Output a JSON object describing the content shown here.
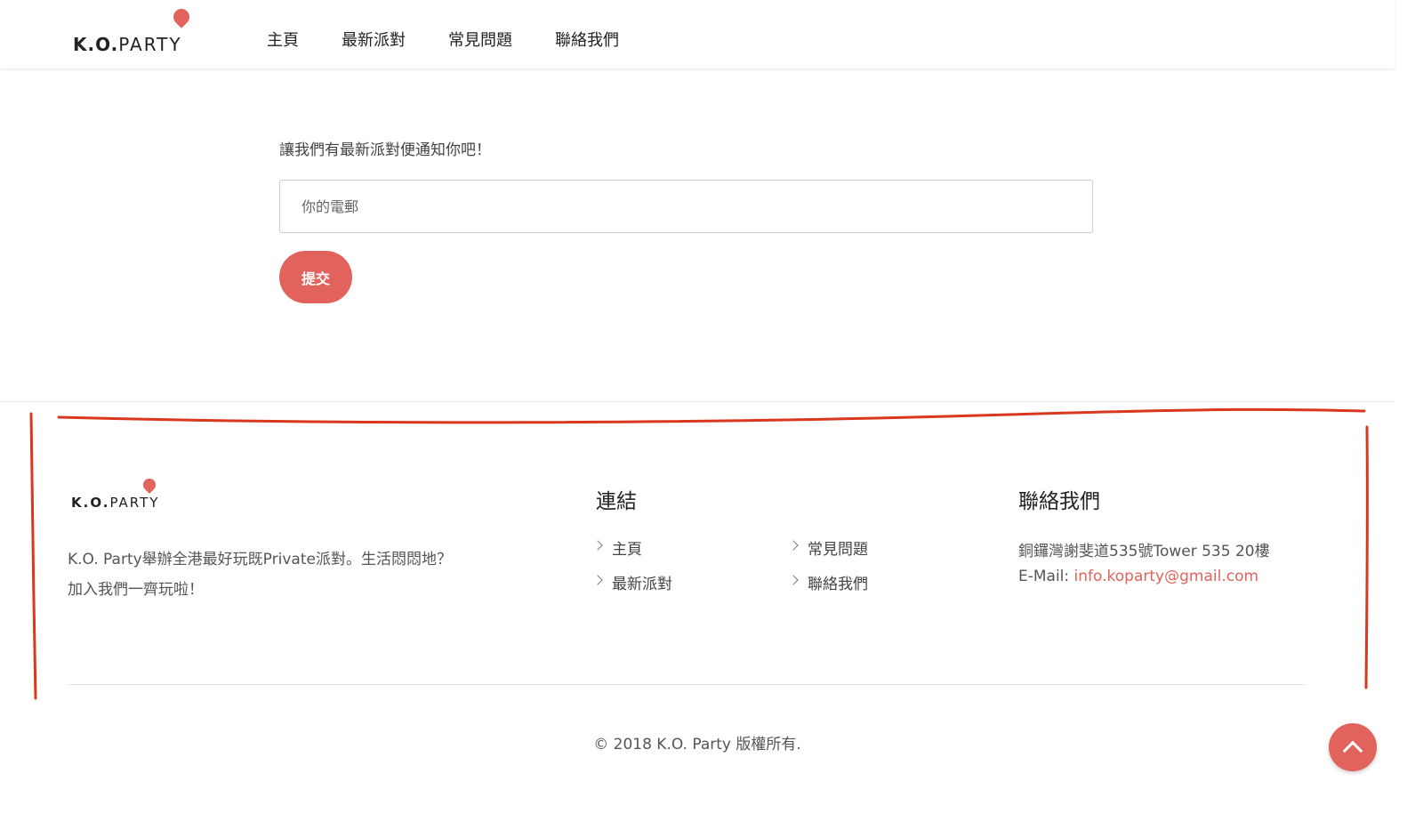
{
  "header": {
    "logo_ko": "K.O.",
    "logo_party": "PARTY",
    "nav": [
      "主頁",
      "最新派對",
      "常見問題",
      "聯絡我們"
    ]
  },
  "subscribe": {
    "prompt": "讓我們有最新派對便通知你吧！",
    "email_placeholder": "你的電郵",
    "submit_label": "提交"
  },
  "footer": {
    "logo_ko": "K.O.",
    "logo_party": "PARTY",
    "description": "K.O. Party舉辦全港最好玩既Private派對。生活悶悶地？加入我們一齊玩啦！",
    "links_title": "連結",
    "links": [
      "主頁",
      "常見問題",
      "最新派對",
      "聯絡我們"
    ],
    "contact_title": "聯絡我們",
    "address": "銅鑼灣謝斐道535號Tower 535 20樓",
    "email_label": "E-Mail: ",
    "email": "info.koparty@gmail.com",
    "copyright": "© 2018 K.O. Party 版權所有."
  },
  "colors": {
    "accent": "#e2625c",
    "annotation": "#d9381e"
  },
  "icons": {
    "logo_pin": "map-pin-icon",
    "link_bullet": "chevron-right-icon",
    "back_to_top": "chevron-up-icon"
  }
}
